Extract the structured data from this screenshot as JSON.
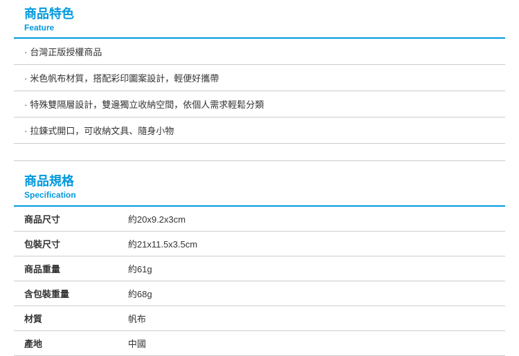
{
  "feature_section": {
    "title": "商品特色",
    "subtitle": "Feature",
    "items": [
      "台灣正版授權商品",
      "米色帆布材質，搭配彩印圖案設計，輕便好攜帶",
      "特殊雙隔層設計，雙邊獨立收納空間，依個人需求輕鬆分類",
      "拉鍊式開口，可收納文具、隨身小物"
    ]
  },
  "spec_section": {
    "title": "商品規格",
    "subtitle": "Specification",
    "rows": [
      {
        "label": "商品尺寸",
        "value": "約20x9.2x3cm"
      },
      {
        "label": "包裝尺寸",
        "value": "約21x11.5x3.5cm"
      },
      {
        "label": "商品重量",
        "value": "約61g"
      },
      {
        "label": "含包裝重量",
        "value": "約68g"
      },
      {
        "label": "材質",
        "value": "帆布"
      },
      {
        "label": "產地",
        "value": "中國"
      }
    ]
  }
}
